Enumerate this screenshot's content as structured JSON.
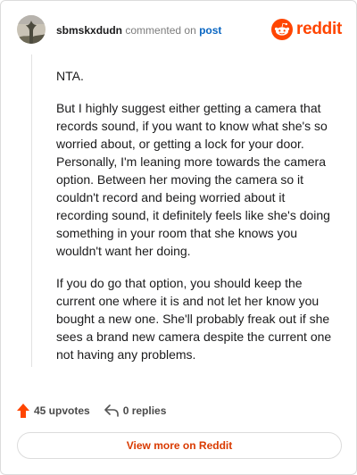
{
  "comment": {
    "username": "sbmskxdudn",
    "action": "commented on",
    "post_link": "post",
    "paragraphs": [
      "NTA.",
      "But I highly suggest either getting a camera that records sound, if you want to know what she's so worried about, or getting a lock for your door. Personally, I'm leaning more towards the camera option. Between her moving the camera so it couldn't record and being worried about it recording sound, it definitely feels like she's doing something in your room that she knows you wouldn't want her doing.",
      "If you do go that option, you should keep the current one where it is and not let her know you bought a new one. She'll probably freak out if she sees a brand new camera despite the current one not having any problems."
    ]
  },
  "brand": {
    "name": "reddit",
    "color": "#ff4500",
    "icon": "reddit-snoo-icon"
  },
  "footer": {
    "upvotes": "45 upvotes",
    "replies": "0 replies",
    "view_more": "View more on Reddit"
  },
  "icons": {
    "upvote": "upvote-arrow-icon",
    "reply": "reply-arrow-icon",
    "avatar": "user-avatar"
  },
  "colors": {
    "accent": "#ff4500",
    "link": "#0a66c2",
    "button_text": "#d93a00"
  }
}
